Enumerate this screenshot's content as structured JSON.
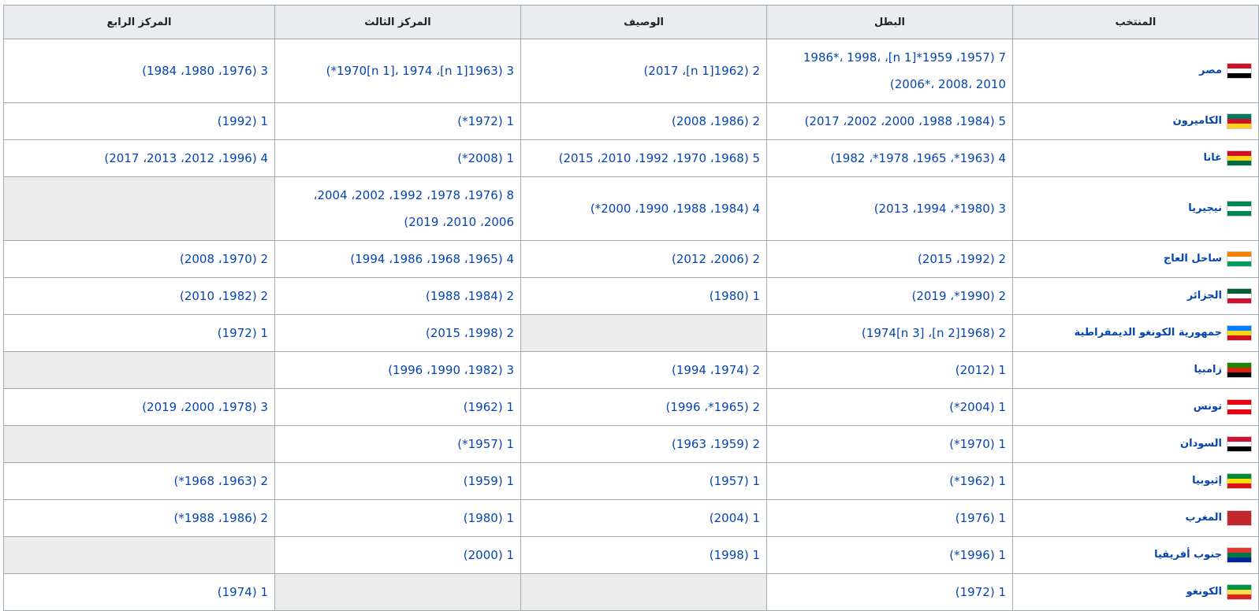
{
  "headers": [
    "المنتخب",
    "البطل",
    "الوصيف",
    "المركز الثالث",
    "المركز الرابع"
  ],
  "rows": [
    {
      "team": "مصر",
      "flag_colors": [
        "#ce1126",
        "#ffffff",
        "#000000"
      ],
      "winner": "7 (1957، 1959*[n 1]، 1986*، 1998، 2006*، 2008، 2010)",
      "runner": "2 (1962[n 1]، 2017)",
      "third": "3 (1963[n 1]، 1970[n 1]، 1974*)",
      "fourth": "3 (1976، 1980، 1984)"
    },
    {
      "team": "الكاميرون",
      "flag_colors": [
        "#007a5e",
        "#ce1126",
        "#fcd116"
      ],
      "winner": "5 (1984، 1988، 2000، 2002، 2017)",
      "runner": "2 (1986، 2008)",
      "third": "1 (1972*)",
      "fourth": "1 (1992)"
    },
    {
      "team": "غانا",
      "flag_colors": [
        "#ce1126",
        "#fcd116",
        "#006b3f"
      ],
      "winner": "4 (1963*، 1965، 1978*، 1982)",
      "runner": "5 (1968، 1970، 1992، 2010، 2015)",
      "third": "1 (2008*)",
      "fourth": "4 (1996، 2012، 2013، 2017)"
    },
    {
      "team": "نيجيريا",
      "flag_colors": [
        "#008751",
        "#ffffff",
        "#008751"
      ],
      "winner": "3 (1980*، 1994، 2013)",
      "runner": "4 (1984، 1988، 1990، 2000*)",
      "third": "8 (1976، 1978، 1992، 2002، 2004، 2006، 2010، 2019)",
      "fourth": ""
    },
    {
      "team": "ساحل العاج",
      "flag_colors": [
        "#f77f00",
        "#ffffff",
        "#009e60"
      ],
      "winner": "2 (1992، 2015)",
      "runner": "2 (2006، 2012)",
      "third": "4 (1965، 1968، 1986، 1994)",
      "fourth": "2 (1970، 2008)"
    },
    {
      "team": "الجزائر",
      "flag_colors": [
        "#006233",
        "#ffffff",
        "#d21034"
      ],
      "winner": "2 (1990*، 2019)",
      "runner": "1 (1980)",
      "third": "2 (1984، 1988)",
      "fourth": "2 (1982، 2010)"
    },
    {
      "team": "جمهورية الكونغو الديمقراطية",
      "flag_colors": [
        "#007fff",
        "#f7d618",
        "#ce1021"
      ],
      "winner": "2 (1968[n 2]، 1974[n 3])",
      "runner": "",
      "third": "2 (1998، 2015)",
      "fourth": "1 (1972)"
    },
    {
      "team": "زامبيا",
      "flag_colors": [
        "#198a00",
        "#de2010",
        "#000000"
      ],
      "winner": "1 (2012)",
      "runner": "2 (1974، 1994)",
      "third": "3 (1982، 1990، 1996)",
      "fourth": ""
    },
    {
      "team": "تونس",
      "flag_colors": [
        "#e70013",
        "#ffffff",
        "#e70013"
      ],
      "winner": "1 (2004*)",
      "runner": "2 (1965*، 1996)",
      "third": "1 (1962)",
      "fourth": "3 (1978، 2000، 2019)"
    },
    {
      "team": "السودان",
      "flag_colors": [
        "#d21034",
        "#ffffff",
        "#000000"
      ],
      "winner": "1 (1970*)",
      "runner": "2 (1959، 1963)",
      "third": "1 (1957*)",
      "fourth": ""
    },
    {
      "team": "إثيوبيا",
      "flag_colors": [
        "#078930",
        "#fcdd09",
        "#da121a"
      ],
      "winner": "1 (1962*)",
      "runner": "1 (1957)",
      "third": "1 (1959)",
      "fourth": "2 (1963، 1968*)"
    },
    {
      "team": "المغرب",
      "flag_colors": [
        "#c1272d",
        "#c1272d",
        "#c1272d"
      ],
      "winner": "1 (1976)",
      "runner": "1 (2004)",
      "third": "1 (1980)",
      "fourth": "2 (1986، 1988*)"
    },
    {
      "team": "جنوب أفريقيا",
      "flag_colors": [
        "#de3831",
        "#007749",
        "#002395"
      ],
      "winner": "1 (1996*)",
      "runner": "1 (1998)",
      "third": "1 (2000)",
      "fourth": ""
    },
    {
      "team": "الكونغو",
      "flag_colors": [
        "#009543",
        "#fbde4a",
        "#dc241f"
      ],
      "winner": "1 (1972)",
      "runner": "",
      "third": "",
      "fourth": "1 (1974)"
    }
  ]
}
